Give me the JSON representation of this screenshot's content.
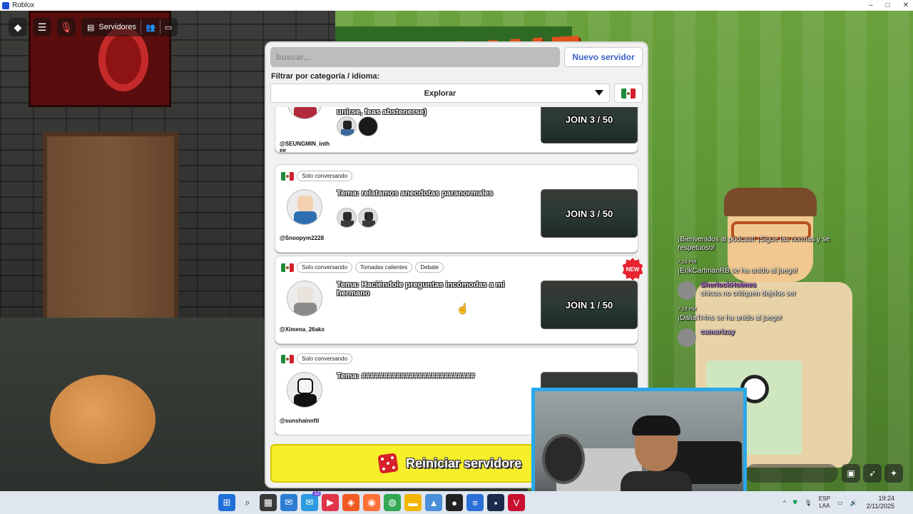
{
  "window": {
    "title": "Roblox"
  },
  "toolbar": {
    "servers_label": "Servidores"
  },
  "scene": {
    "sign_text": "ALLOWE"
  },
  "panel": {
    "search_placeholder": "buscar...",
    "new_server_label": "Nuevo servidor",
    "filter_label": "Filtrar por categoría / idioma:",
    "category_value": "Explorar",
    "reset_label": "Reiniciar servidore"
  },
  "servers": [
    {
      "tags": [],
      "topic": "unirse, feas abstenerse)",
      "host": "@SEUNGMIN_inth ee",
      "join": "JOIN 3 / 50",
      "new": ""
    },
    {
      "tags": [
        "Solo conversando"
      ],
      "topic": "Tema: relatamos anecdotas paranormales",
      "host": "@Snoopym2228",
      "join": "JOIN 3 / 50",
      "new": ""
    },
    {
      "tags": [
        "Solo conversando",
        "Tomadas calientes",
        "Debate"
      ],
      "topic": "Tema: Haciéndole preguntas incómodas a mi hermano",
      "host": "@Ximena_26akx",
      "join": "JOIN 1 / 50",
      "new": "NEW"
    },
    {
      "tags": [
        "Solo conversando"
      ],
      "topic": "Tema: ##########################",
      "host": "@sunshainnftl",
      "join": "",
      "new": ""
    }
  ],
  "chat": {
    "welcome": "¡Bienvenidos al podcast! ¡Sigue las normas y sé respetuoso!",
    "messages": [
      {
        "time": "7:23 PM",
        "text": "¡ErikCartmanRB se ha unido al juego!"
      },
      {
        "user": "SherlockHolmes",
        "text": "chicos no critiquen dejelos ser"
      },
      {
        "time": "7:23 PM",
        "text": "¡DaliaTr4ns se ha unido al juego!"
      },
      {
        "user": "camarizay"
      }
    ]
  },
  "taskbar": {
    "lang_top": "ESP",
    "lang_bottom": "LAA",
    "time": "19:24",
    "date": "2/11/2025",
    "badge": "12"
  },
  "colors": {
    "accent": "#3b61c9",
    "reset_yellow": "#f7ef2a",
    "webcam_border": "#29a9e8",
    "new_badge": "#e6232f"
  }
}
